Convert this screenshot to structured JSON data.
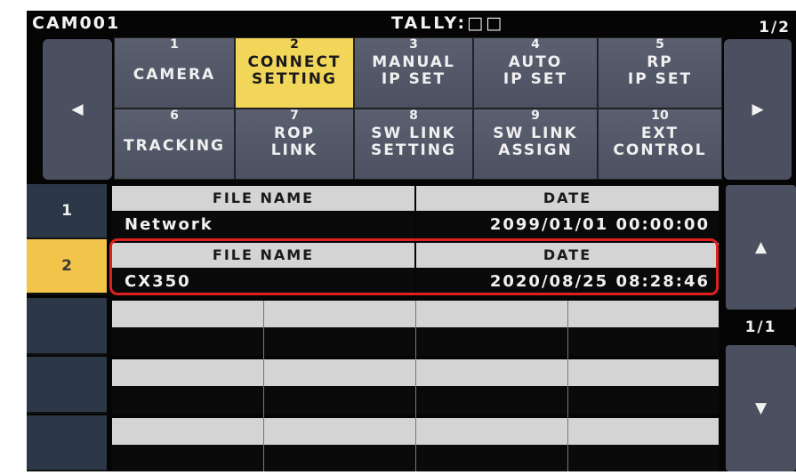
{
  "header": {
    "cam": "CAM001",
    "tally": "TALLY:□□",
    "page": "1/2"
  },
  "nav": {
    "left_arrow": "◀",
    "right_arrow": "▶",
    "up_arrow": "▲",
    "down_arrow": "▼",
    "list_page": "1/1"
  },
  "menu": [
    {
      "num": "1",
      "label": "CAMERA"
    },
    {
      "num": "2",
      "label": "CONNECT\nSETTING"
    },
    {
      "num": "3",
      "label": "MANUAL\nIP SET"
    },
    {
      "num": "4",
      "label": "AUTO\nIP SET"
    },
    {
      "num": "5",
      "label": "RP\nIP SET"
    },
    {
      "num": "6",
      "label": "TRACKING"
    },
    {
      "num": "7",
      "label": "ROP\nLINK"
    },
    {
      "num": "8",
      "label": "SW LINK\nSETTING"
    },
    {
      "num": "9",
      "label": "SW LINK\nASSIGN"
    },
    {
      "num": "10",
      "label": "EXT\nCONTROL"
    }
  ],
  "list": {
    "col_file": "FILE NAME",
    "col_date": "DATE",
    "rows": [
      {
        "num": "1",
        "file": "Network",
        "date": "2099/01/01 00:00:00"
      },
      {
        "num": "2",
        "file": "CX350",
        "date": "2020/08/25 08:28:46"
      }
    ]
  }
}
